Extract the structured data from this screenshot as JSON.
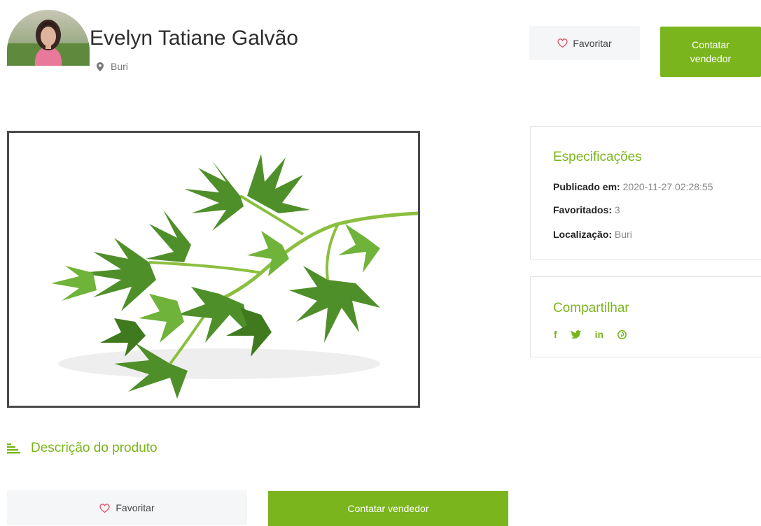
{
  "seller": {
    "name": "Evelyn Tatiane Galvão",
    "location": "Buri"
  },
  "actions": {
    "favorite_label": "Favoritar",
    "contact_label": "Contatar vendedor"
  },
  "specs": {
    "title": "Especificações",
    "published_label": "Publicado em:",
    "published_value": "2020-11-27 02:28:55",
    "favorites_label": "Favoritados:",
    "favorites_value": "3",
    "location_label": "Localização:",
    "location_value": "Buri"
  },
  "share": {
    "title": "Compartilhar",
    "networks": [
      "f",
      "twitter-icon",
      "in",
      "pinterest-icon"
    ]
  },
  "description": {
    "heading": "Descrição do produto"
  },
  "colors": {
    "accent": "#7ab51d",
    "button_bg": "#f5f6f7"
  }
}
